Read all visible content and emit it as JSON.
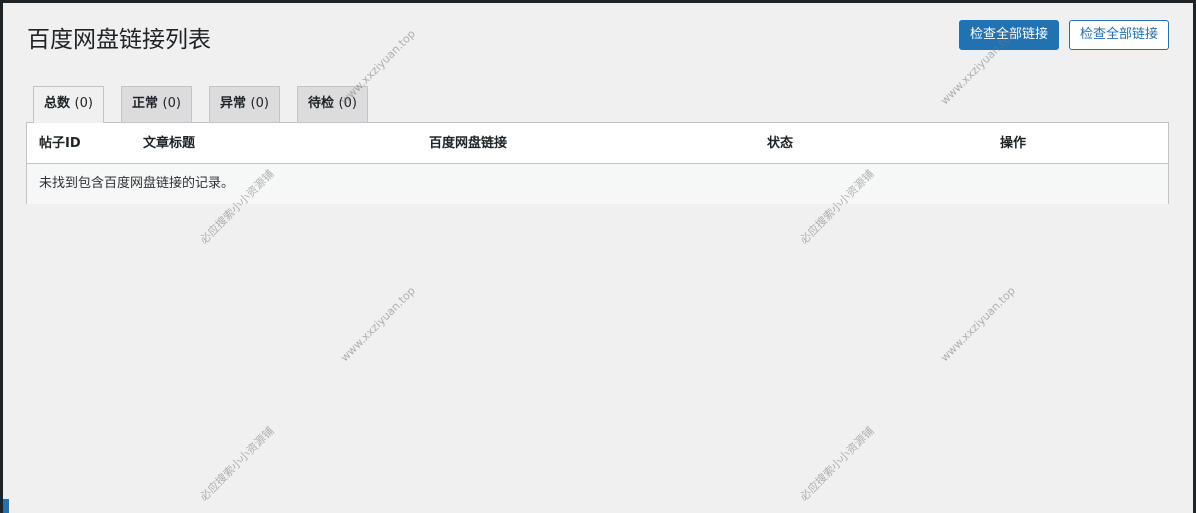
{
  "page": {
    "title": "百度网盘链接列表"
  },
  "actions": {
    "primary_label": "检查全部链接",
    "secondary_label": "检查全部链接"
  },
  "tabs": [
    {
      "label": "总数",
      "count": "(0)"
    },
    {
      "label": "正常",
      "count": "(0)"
    },
    {
      "label": "异常",
      "count": "(0)"
    },
    {
      "label": "待检",
      "count": "(0)"
    }
  ],
  "table": {
    "columns": [
      "帖子ID",
      "文章标题",
      "百度网盘链接",
      "状态",
      "操作"
    ],
    "empty_message": "未找到包含百度网盘链接的记录。"
  },
  "watermarks": {
    "url": "www.xxziyuan.top",
    "cn": "必应搜索小小资源铺"
  },
  "colors": {
    "accent": "#2271b1",
    "background": "#f0f0f1"
  }
}
